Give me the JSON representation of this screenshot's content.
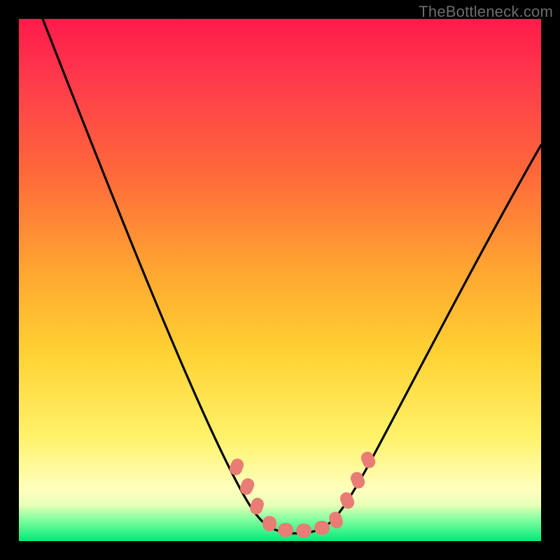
{
  "watermark": "TheBottleneck.com",
  "chart_data": {
    "type": "line",
    "title": "",
    "xlabel": "",
    "ylabel": "",
    "xlim": [
      0,
      100
    ],
    "ylim": [
      0,
      100
    ],
    "legend": false,
    "grid": false,
    "background_gradient": {
      "direction": "vertical",
      "stops": [
        {
          "pos": 0,
          "color": "#ff1a4b"
        },
        {
          "pos": 30,
          "color": "#ff6a3a"
        },
        {
          "pos": 64,
          "color": "#ffd233"
        },
        {
          "pos": 90,
          "color": "#ffffbd"
        },
        {
          "pos": 100,
          "color": "#00e977"
        }
      ]
    },
    "series": [
      {
        "name": "bottleneck-curve",
        "color": "#000000",
        "x": [
          0,
          5,
          10,
          15,
          20,
          25,
          30,
          35,
          40,
          43,
          46,
          50,
          55,
          58,
          61,
          64,
          70,
          76,
          82,
          88,
          94,
          100
        ],
        "y": [
          100,
          90,
          80,
          70,
          59,
          48,
          37,
          26,
          14,
          8,
          4,
          2,
          2,
          4,
          8,
          14,
          25,
          36,
          47,
          57,
          66,
          74
        ]
      }
    ],
    "markers": {
      "name": "highlight-points",
      "color": "#e97c74",
      "shape": "rounded-rect",
      "points": [
        {
          "x": 40,
          "y": 14
        },
        {
          "x": 42,
          "y": 10
        },
        {
          "x": 44,
          "y": 6
        },
        {
          "x": 47,
          "y": 3
        },
        {
          "x": 50,
          "y": 2
        },
        {
          "x": 53,
          "y": 2
        },
        {
          "x": 56,
          "y": 2
        },
        {
          "x": 59,
          "y": 4
        },
        {
          "x": 61,
          "y": 8
        },
        {
          "x": 63,
          "y": 12
        },
        {
          "x": 65,
          "y": 16
        }
      ]
    }
  }
}
